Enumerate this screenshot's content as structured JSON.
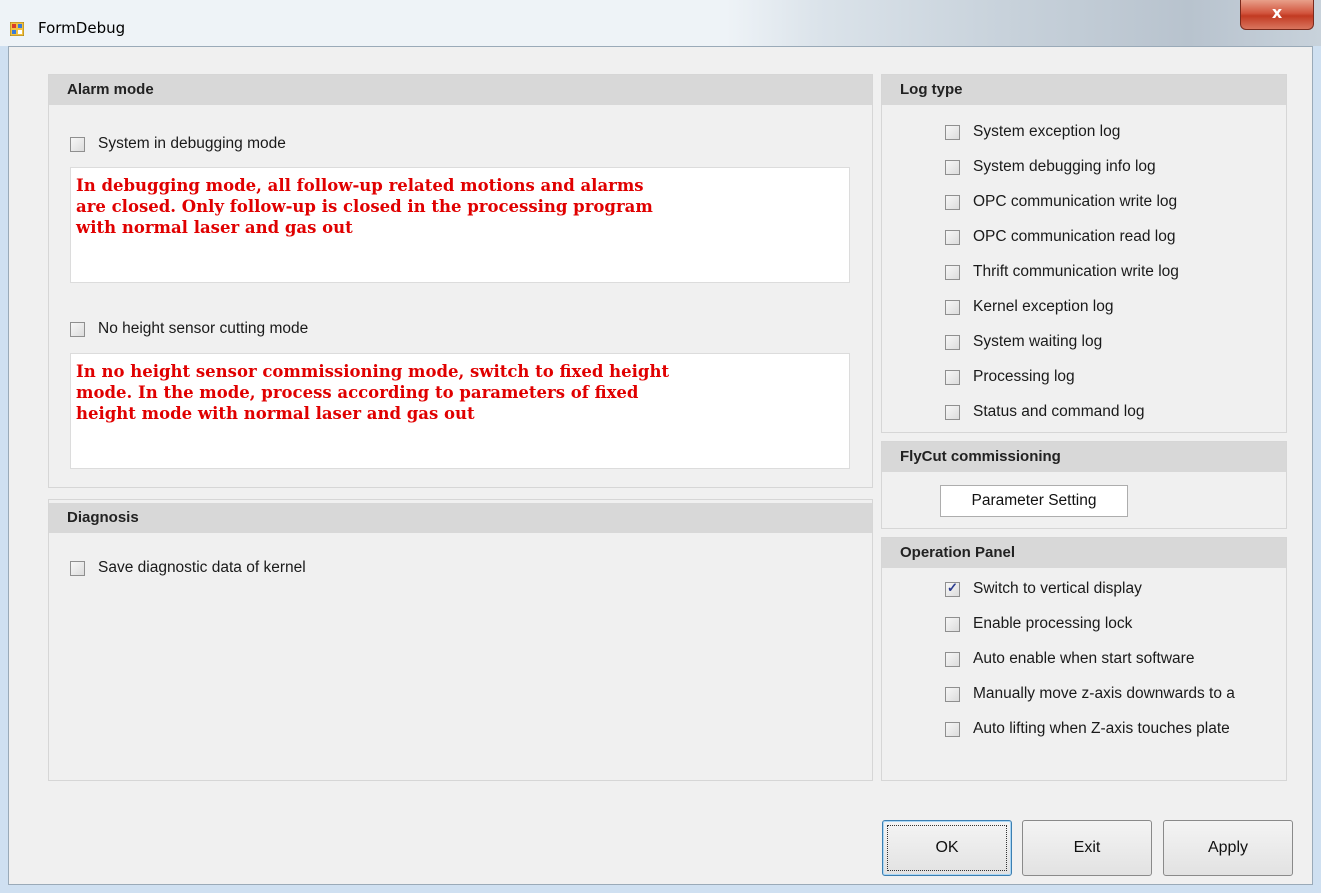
{
  "window": {
    "title": "FormDebug",
    "close_label": "x"
  },
  "alarm_mode": {
    "header": "Alarm mode",
    "debug_checkbox": {
      "label": "System in debugging mode",
      "checked": false
    },
    "debug_note": "In debugging mode, all follow-up related motions and alarms\nare closed. Only follow-up is closed in the processing program\nwith normal laser and gas out",
    "no_sensor_checkbox": {
      "label": "No height sensor cutting mode",
      "checked": false
    },
    "no_sensor_note": "In no height sensor commissioning mode, switch to fixed height\nmode. In the mode, process according to parameters of fixed\nheight mode with normal laser and gas out"
  },
  "diagnosis": {
    "header": "Diagnosis",
    "save_checkbox": {
      "label": "Save diagnostic data of kernel",
      "checked": false
    }
  },
  "log_type": {
    "header": "Log type",
    "items": [
      {
        "label": "System exception log",
        "checked": false
      },
      {
        "label": "System debugging info log",
        "checked": false
      },
      {
        "label": "OPC communication write log",
        "checked": false
      },
      {
        "label": "OPC communication read log",
        "checked": false
      },
      {
        "label": "Thrift communication write log",
        "checked": false
      },
      {
        "label": "Kernel exception log",
        "checked": false
      },
      {
        "label": "System waiting log",
        "checked": false
      },
      {
        "label": "Processing log",
        "checked": false
      },
      {
        "label": "Status and command log",
        "checked": false
      }
    ]
  },
  "flycut": {
    "header": "FlyCut commissioning",
    "button_label": "Parameter Setting"
  },
  "operation_panel": {
    "header": "Operation Panel",
    "items": [
      {
        "label": "Switch to vertical display",
        "checked": true
      },
      {
        "label": "Enable processing lock",
        "checked": false
      },
      {
        "label": "Auto enable when start software",
        "checked": false
      },
      {
        "label": "Manually move z-axis downwards to a",
        "checked": false
      },
      {
        "label": "Auto lifting when Z-axis touches plate",
        "checked": false
      }
    ]
  },
  "footer": {
    "ok_label": "OK",
    "exit_label": "Exit",
    "apply_label": "Apply"
  }
}
